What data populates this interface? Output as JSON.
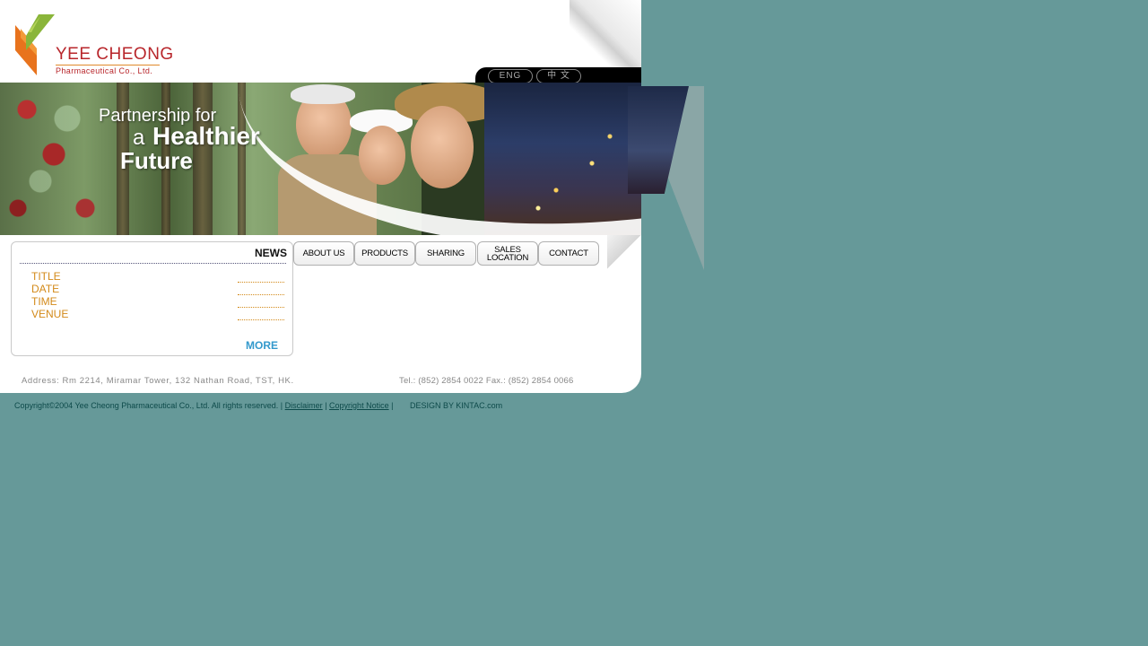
{
  "header": {
    "logo_name": "YEE CHEONG",
    "logo_sub": "Pharmaceutical Co., Ltd.",
    "lang_eng": "ENG",
    "lang_chi": "中 文"
  },
  "banner": {
    "slogan_line1": "Partnership for",
    "slogan_line2a": "a",
    "slogan_line2b": "Healthier",
    "slogan_line3": "Future"
  },
  "news": {
    "title": "NEWS",
    "labels": [
      "TITLE",
      "DATE",
      "TIME",
      "VENUE"
    ],
    "more": "MORE"
  },
  "nav": {
    "items": [
      "ABOUT US",
      "PRODUCTS",
      "SHARING",
      "SALES\nLOCATION",
      "CONTACT"
    ]
  },
  "footer": {
    "address": "Address: Rm 2214, Miramar Tower, 132 Nathan Road, TST, HK.",
    "tel_fax": "Tel.: (852) 2854 0022  Fax.: (852) 2854 0066",
    "copyright": "Copyright©2004 Yee Cheong Pharmaceutical Co., Ltd. All rights reserved. |",
    "disclaimer": "Disclaimer",
    "sep": "|",
    "copyright_notice": "Copyright Notice",
    "sep2": "|",
    "design": "DESIGN BY KINTAC.com"
  },
  "colors": {
    "page_bg": "#669999",
    "brand_red": "#b8262b",
    "news_label": "#d38a1a",
    "more_link": "#3399cc"
  }
}
